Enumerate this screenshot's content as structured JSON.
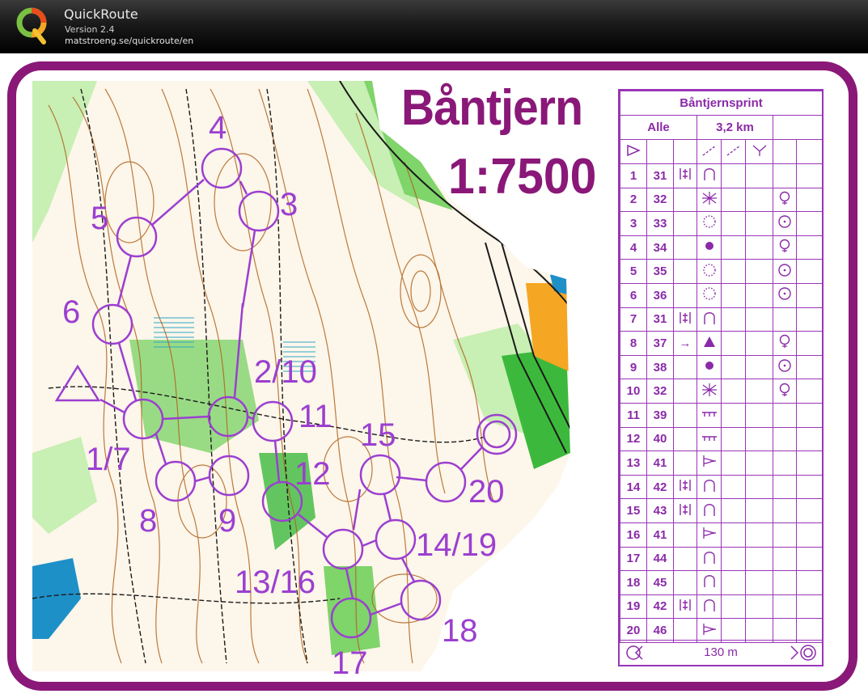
{
  "app": {
    "name": "QuickRoute",
    "version": "Version 2.4",
    "url": "matstroeng.se/quickroute/en"
  },
  "map": {
    "title": "Båntjern",
    "scale": "1:7500",
    "control_labels": [
      "4",
      "3",
      "5",
      "6",
      "2/10",
      "11",
      "1/7",
      "15",
      "12",
      "8",
      "9",
      "20",
      "14/19",
      "13/16",
      "18",
      "17"
    ]
  },
  "description_sheet": {
    "event": "Båntjernsprint",
    "class": "Alle",
    "length": "3,2 km",
    "start_symbol": "start-triangle-icon",
    "rows": [
      {
        "num": "1",
        "code": "31",
        "dir": "|◊|",
        "feature": "re-entrant-icon",
        "extra": ""
      },
      {
        "num": "2",
        "code": "32",
        "dir": "",
        "feature": "thicket-icon",
        "extra": "foot-icon"
      },
      {
        "num": "3",
        "code": "33",
        "dir": "",
        "feature": "dotted-circle-icon",
        "extra": "circle-icon"
      },
      {
        "num": "4",
        "code": "34",
        "dir": "",
        "feature": "dot-icon",
        "extra": "foot-icon"
      },
      {
        "num": "5",
        "code": "35",
        "dir": "",
        "feature": "dotted-circle-icon",
        "extra": "circle-icon"
      },
      {
        "num": "6",
        "code": "36",
        "dir": "",
        "feature": "dotted-circle-icon",
        "extra": "circle-icon"
      },
      {
        "num": "7",
        "code": "31",
        "dir": "|◊|",
        "feature": "re-entrant-icon",
        "extra": ""
      },
      {
        "num": "8",
        "code": "37",
        "dir": "→",
        "feature": "triangle-icon",
        "extra": "foot-icon"
      },
      {
        "num": "9",
        "code": "38",
        "dir": "",
        "feature": "dot-icon",
        "extra": "circle-icon"
      },
      {
        "num": "10",
        "code": "32",
        "dir": "",
        "feature": "thicket-icon",
        "extra": "foot-icon"
      },
      {
        "num": "11",
        "code": "39",
        "dir": "",
        "feature": "fence-icon",
        "extra": ""
      },
      {
        "num": "12",
        "code": "40",
        "dir": "",
        "feature": "fence-icon",
        "extra": ""
      },
      {
        "num": "13",
        "code": "41",
        "dir": "",
        "feature": "path-end-icon",
        "extra": ""
      },
      {
        "num": "14",
        "code": "42",
        "dir": "|◊|",
        "feature": "re-entrant-icon",
        "extra": ""
      },
      {
        "num": "15",
        "code": "43",
        "dir": "|◊|",
        "feature": "re-entrant-icon",
        "extra": ""
      },
      {
        "num": "16",
        "code": "41",
        "dir": "",
        "feature": "path-end-icon",
        "extra": ""
      },
      {
        "num": "17",
        "code": "44",
        "dir": "",
        "feature": "re-entrant-icon",
        "extra": ""
      },
      {
        "num": "18",
        "code": "45",
        "dir": "",
        "feature": "re-entrant-icon",
        "extra": ""
      },
      {
        "num": "19",
        "code": "42",
        "dir": "|◊|",
        "feature": "re-entrant-icon",
        "extra": ""
      },
      {
        "num": "20",
        "code": "46",
        "dir": "",
        "feature": "path-end-icon",
        "extra": ""
      }
    ],
    "finish_distance": "130 m"
  },
  "colors": {
    "frame": "#8a1878",
    "course": "#9b3fd0",
    "forest": "#ffffff",
    "open_green": "#3cb93c",
    "contour": "#b0641e",
    "water": "#1e90c8"
  }
}
